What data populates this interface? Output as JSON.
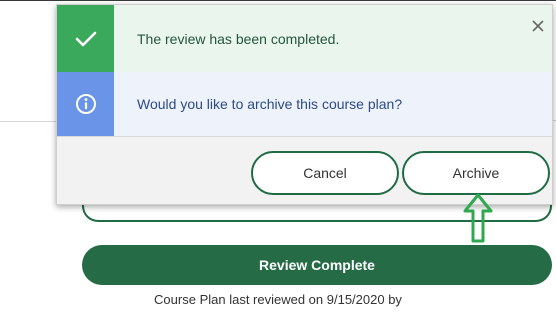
{
  "dialog": {
    "success_message": "The review has been completed.",
    "question": "Would you like to archive this course plan?",
    "cancel_label": "Cancel",
    "archive_label": "Archive"
  },
  "page": {
    "review_complete_label": "Review Complete",
    "last_reviewed_text": "Course Plan last reviewed on 9/15/2020 by"
  },
  "colors": {
    "success_green": "#3aa95b",
    "info_blue": "#6a94e8",
    "primary_green": "#246b46",
    "arrow_green": "#2fa84f"
  },
  "icons": {
    "success": "checkmark-icon",
    "info": "info-circle-icon",
    "close": "close-icon",
    "annotation": "up-arrow-icon"
  }
}
